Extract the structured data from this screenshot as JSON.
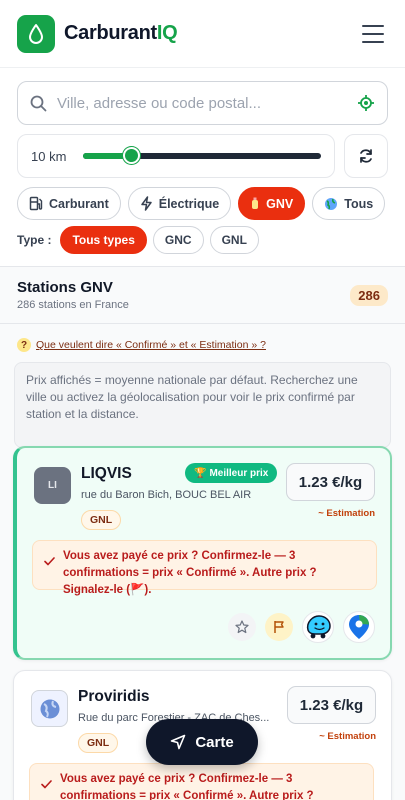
{
  "header": {
    "brand_main": "Carburant",
    "brand_accent": "IQ",
    "accent_color": "#16a34a",
    "logo_icon": "drop-icon",
    "menu_icon": "hamburger-icon"
  },
  "search": {
    "placeholder": "Ville, adresse ou code postal...",
    "value": ""
  },
  "radius": {
    "label": "10 km",
    "slider_fraction": 0.2
  },
  "fuel_tabs": [
    {
      "label": "Carburant",
      "icon": "fuel-pump-icon",
      "active": false
    },
    {
      "label": "Électrique",
      "icon": "lightning-icon",
      "active": false
    },
    {
      "label": "GNV",
      "icon": "gas-cylinder-icon",
      "active": true
    },
    {
      "label": "Tous",
      "icon": "globe-icon",
      "active": false
    }
  ],
  "type_filter": {
    "label": "Type :",
    "options": [
      {
        "label": "Tous types",
        "active": true
      },
      {
        "label": "GNC",
        "active": false
      },
      {
        "label": "GNL",
        "active": false
      }
    ]
  },
  "stations_header": {
    "title": "Stations GNV",
    "subtitle": "286 stations en France",
    "count": "286"
  },
  "faq": {
    "icon_text": "?",
    "link": "Que veulent dire « Confirmé » et « Estimation » ?"
  },
  "info_text": "Prix affichés = moyenne nationale par défaut. Recherchez une ville ou activez la géolocalisation pour voir le prix confirmé par station et la distance.",
  "stations": [
    {
      "initials": "LI",
      "name": "LIQVIS",
      "badge": "Meilleur prix",
      "address": "rue du Baron Bich, BOUC BEL AIR",
      "fuel_tag": "GNL",
      "price": "1.23 €/kg",
      "price_status": "~ Estimation",
      "confirm_text": "Vous avez payé ce prix ? Confirmez-le — 3 confirmations = prix « Confirmé ». Autre prix ? Signalez-le (🚩)."
    },
    {
      "initials": "",
      "name": "Proviridis",
      "address": "Rue du parc Forestier - ZAC de Ches...",
      "fuel_tag": "GNL",
      "price": "1.23 €/kg",
      "price_status": "~ Estimation",
      "confirm_text": "Vous avez payé ce prix ? Confirmez-le — 3 confirmations = prix « Confirmé ». Autre prix ? Signalez-le (🚩)."
    }
  ],
  "map_button": {
    "label": "Carte",
    "icon": "navigation-arrow-icon"
  }
}
